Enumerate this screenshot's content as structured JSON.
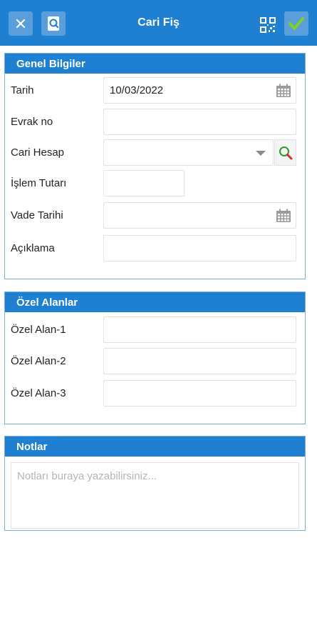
{
  "toolbar": {
    "title": "Cari Fiş",
    "close_icon": "close-icon",
    "search_icon": "document-search-icon",
    "qr_icon": "qr-scan-icon",
    "confirm_icon": "check-icon",
    "accent": "#1f7fd1"
  },
  "genel": {
    "header": "Genel Bilgiler",
    "tarih_label": "Tarih",
    "tarih_value": "10/03/2022",
    "evrak_label": "Evrak no",
    "evrak_value": "",
    "cari_label": "Cari Hesap",
    "cari_value": "",
    "islem_label": "İşlem Tutarı",
    "islem_value": "",
    "vade_label": "Vade Tarihi",
    "vade_value": "",
    "aciklama_label": "Açıklama",
    "aciklama_value": ""
  },
  "ozel": {
    "header": "Özel Alanlar",
    "alan1_label": "Özel Alan-1",
    "alan2_label": "Özel Alan-2",
    "alan3_label": "Özel Alan-3"
  },
  "notlar": {
    "header": "Notlar",
    "placeholder": "Notları buraya yazabilirsiniz..."
  }
}
